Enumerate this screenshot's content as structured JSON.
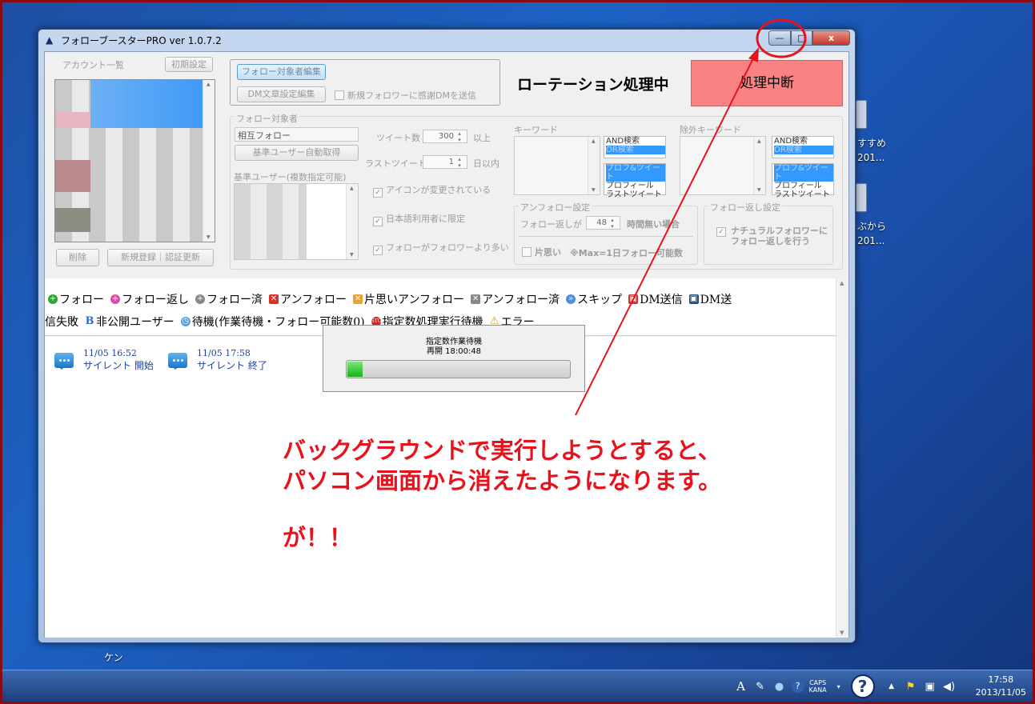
{
  "window": {
    "title": "フォローブースターPRO ver 1.0.7.2",
    "minimize_glyph": "—",
    "maximize_glyph": "□",
    "close_glyph": "x"
  },
  "accounts": {
    "label": "アカウント一覧",
    "reset_button": "初期設定",
    "delete_button": "削除",
    "register_button": "新規登録｜認証更新"
  },
  "top_controls": {
    "edit_targets_button": "フォロー対象者編集",
    "edit_dm_button": "DM文章設定編集",
    "thanks_dm_checkbox": "新規フォロワーに感謝DMを送信",
    "status_text": "ローテーション処理中",
    "stop_button": "処理中断",
    "stop_color": "#f98383"
  },
  "follow_targets": {
    "group_label": "フォロー対象者",
    "mode_value": "相互フォロー",
    "auto_fetch_button": "基準ユーザー自動取得",
    "base_users_label": "基準ユーザー(複数指定可能)",
    "tweet_count_label": "ツイート数",
    "tweet_count_value": "300",
    "tweet_count_unit": "以上",
    "last_tweet_label": "ラストツイート",
    "last_tweet_value": "1",
    "last_tweet_unit": "日以内",
    "icon_changed_check": "アイコンが変更されている",
    "japanese_only_check": "日本語利用者に限定",
    "follows_more_check": "フォローがフォロワーより多い"
  },
  "keyword": {
    "label": "キーワード",
    "search_options": [
      "AND検索",
      "OR検索"
    ],
    "field_options": [
      "プロフ&ツイート",
      "プロフィール",
      "ラストツイート"
    ]
  },
  "exclude_keyword": {
    "label": "除外キーワード",
    "search_options": [
      "AND検索",
      "OR検索"
    ],
    "field_options": [
      "プロフ&ツイート",
      "プロフィール",
      "ラストツイート"
    ]
  },
  "unfollow": {
    "group_label": "アンフォロー設定",
    "prefix": "フォロー返しが",
    "hours_value": "48",
    "suffix": "時間無い場合",
    "oneway_check": "片思い",
    "oneway_note": "※Max=1日フォロー可能数"
  },
  "followback": {
    "group_label": "フォロー返し設定",
    "natural_check_line1": "ナチュラルフォロワーに",
    "natural_check_line2": "フォロー返しを行う"
  },
  "legend": {
    "row1": [
      {
        "icon": "plus-green",
        "label": "フォロー"
      },
      {
        "icon": "plus-pink",
        "label": "フォロー返し"
      },
      {
        "icon": "plus-gray",
        "label": "フォロー済"
      },
      {
        "icon": "x-red",
        "label": "アンフォロー"
      },
      {
        "icon": "x-orange",
        "label": "片思いアンフォロー"
      },
      {
        "icon": "x-gray",
        "label": "アンフォロー済"
      },
      {
        "icon": "skip",
        "label": "スキップ"
      },
      {
        "icon": "gift-red",
        "label": "DM送信"
      },
      {
        "icon": "gift-dark",
        "label": "DM送"
      }
    ],
    "row2": [
      {
        "icon": "none",
        "label": "信失敗"
      },
      {
        "icon": "b-blue",
        "label": "非公開ユーザー"
      },
      {
        "icon": "clock",
        "label": "待機(作業待機・フォロー可能数0)"
      },
      {
        "icon": "stop",
        "label": "指定数処理実行待機"
      },
      {
        "icon": "warning",
        "label": "エラー"
      }
    ]
  },
  "log": [
    {
      "time": "11/05 16:52",
      "message": "サイレント 開始"
    },
    {
      "time": "11/05 17:58",
      "message": "サイレント 終了"
    }
  ],
  "wait_popup": {
    "title": "指定数作業待機",
    "resume": "再開 18:00:48",
    "progress": 0.07
  },
  "annotation": {
    "line1": "バックグラウンドで実行しようとすると、",
    "line2": "パソコン画面から消えたようになります。",
    "line3": "が！！",
    "color": "#e8121c"
  },
  "desktop": {
    "item1_line1": "すすめ",
    "item1_line2": "201...",
    "item2_line1": "ぶから",
    "item2_line2": "201...",
    "behind_text": "ケン"
  },
  "taskbar": {
    "ime_glyph": "A",
    "caps_line1": "CAPS",
    "caps_line2": "KANA",
    "help_glyph": "?",
    "time": "17:58",
    "date": "2013/11/05"
  }
}
